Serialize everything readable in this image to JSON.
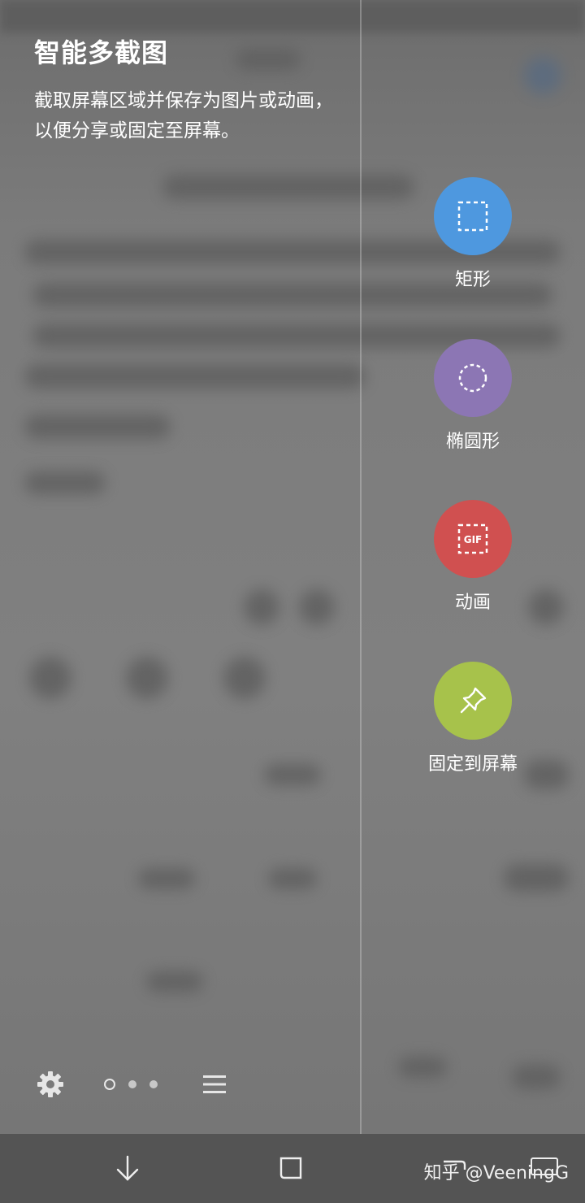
{
  "panel": {
    "title": "智能多截图",
    "description": "截取屏幕区域并保存为图片或动画，以便分享或固定至屏幕。"
  },
  "tools": [
    {
      "label": "矩形",
      "icon": "dashed-rectangle-icon",
      "color": "#4e98df"
    },
    {
      "label": "椭圆形",
      "icon": "dashed-circle-icon",
      "color": "#8c76b4"
    },
    {
      "label": "动画",
      "icon": "gif-icon",
      "icon_text": "GIF",
      "color": "#d05050"
    },
    {
      "label": "固定到屏幕",
      "icon": "pin-icon",
      "color": "#a7c24b"
    }
  ],
  "bottom_bar": {
    "settings_icon": "gear-icon",
    "page_indicator": {
      "pages": 3,
      "current": 1
    },
    "menu_icon": "hamburger-icon"
  },
  "navbar": {
    "buttons": [
      "back-icon",
      "recents-icon",
      "home-icon",
      "keyboard-icon"
    ],
    "watermark": "知乎 @VeeningG"
  }
}
